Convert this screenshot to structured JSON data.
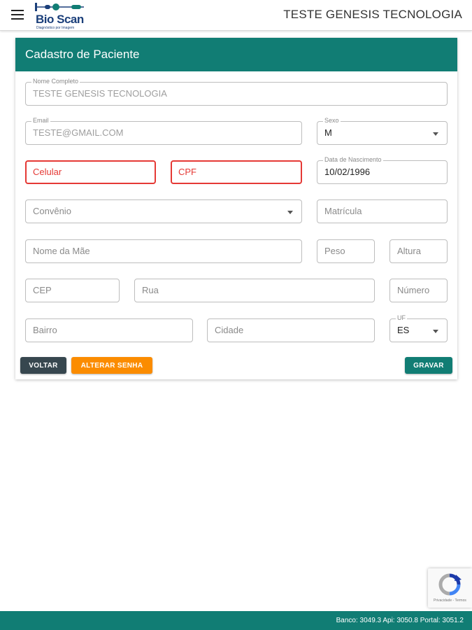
{
  "header": {
    "logo_text": "Bio Scan",
    "logo_subtitle": "Diagnóstico por Imagem",
    "user_name": "TESTE GENESIS TECNOLOGIA"
  },
  "form": {
    "title": "Cadastro de Paciente",
    "nome_completo": {
      "label": "Nome Completo",
      "value": "TESTE GENESIS TECNOLOGIA"
    },
    "email": {
      "label": "Email",
      "value": "TESTE@GMAIL.COM"
    },
    "sexo": {
      "label": "Sexo",
      "value": "M"
    },
    "celular": {
      "placeholder": "Celular"
    },
    "cpf": {
      "placeholder": "CPF"
    },
    "data_nascimento": {
      "label": "Data de Nascimento",
      "value": "10/02/1996"
    },
    "convenio": {
      "placeholder": "Convênio"
    },
    "matricula": {
      "placeholder": "Matrícula"
    },
    "nome_mae": {
      "placeholder": "Nome da Mãe"
    },
    "peso": {
      "placeholder": "Peso"
    },
    "altura": {
      "placeholder": "Altura"
    },
    "cep": {
      "placeholder": "CEP"
    },
    "rua": {
      "placeholder": "Rua"
    },
    "numero": {
      "placeholder": "Número"
    },
    "bairro": {
      "placeholder": "Bairro"
    },
    "cidade": {
      "placeholder": "Cidade"
    },
    "uf": {
      "label": "UF",
      "value": "ES"
    }
  },
  "buttons": {
    "voltar": "VOLTAR",
    "alterar_senha": "ALTERAR SENHA",
    "gravar": "GRAVAR"
  },
  "recaptcha": {
    "text": "Privacidade - Termos"
  },
  "footer": {
    "versions": "Banco: 3049.3 Api: 3050.8 Portal: 3051.2"
  },
  "colors": {
    "primary": "#117d74",
    "error": "#e53935",
    "orange": "#fb8c00",
    "dark": "#37474f"
  },
  "icons": [
    "menu-icon",
    "chevron-down-icon",
    "recaptcha-icon"
  ]
}
